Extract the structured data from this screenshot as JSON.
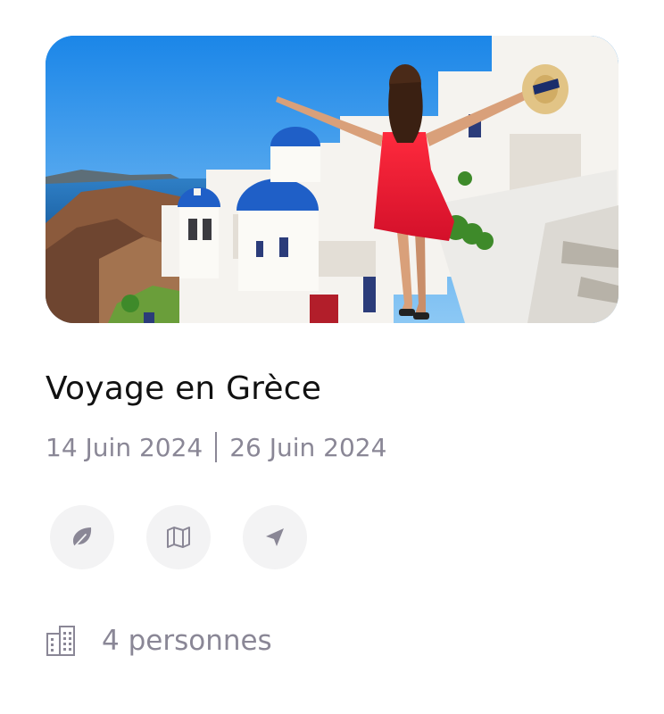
{
  "trip": {
    "title": "Voyage en Grèce",
    "start_date": "14 Juin 2024",
    "end_date": "26 Juin 2024",
    "people": "4 personnes"
  },
  "actions": [
    {
      "icon": "leaf-icon"
    },
    {
      "icon": "map-icon"
    },
    {
      "icon": "send-icon"
    }
  ],
  "colors": {
    "text_primary": "#111111",
    "text_muted": "#8a8796",
    "button_bg": "#f3f3f4",
    "accent_red": "#e4162f",
    "sea_blue": "#2c8fe3"
  },
  "icons": {
    "people": "building-icon"
  }
}
